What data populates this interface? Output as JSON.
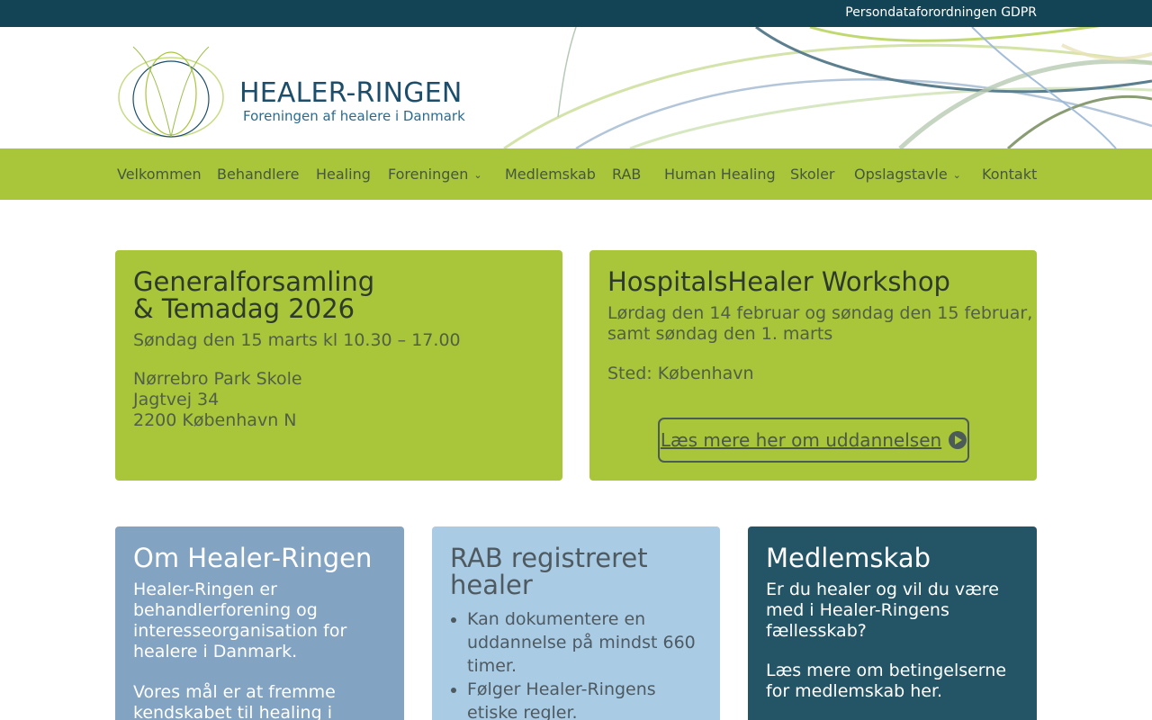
{
  "topbar": {
    "link": "Persondataforordningen GDPR"
  },
  "logo": {
    "title": "HEALER-RINGEN",
    "subtitle": "Foreningen af healere i Danmark"
  },
  "nav": [
    {
      "label": "Velkommen",
      "dropdown": false
    },
    {
      "label": "Behandlere",
      "dropdown": false
    },
    {
      "label": "Healing",
      "dropdown": false
    },
    {
      "label": "Foreningen",
      "dropdown": true
    },
    {
      "label": "Medlemskab",
      "dropdown": false
    },
    {
      "label": "RAB",
      "dropdown": false
    },
    {
      "label": "Human Healing",
      "dropdown": false
    },
    {
      "label": "Skoler",
      "dropdown": false
    },
    {
      "label": "Opslagstavle",
      "dropdown": true
    },
    {
      "label": "Kontakt",
      "dropdown": false
    }
  ],
  "card_general": {
    "title_line1": "Generalforsamling",
    "title_line2": "& Temadag 2026",
    "date": "Søndag den 15 marts kl 10.30 – 17.00",
    "address_line1": "Nørrebro Park Skole",
    "address_line2": "Jagtvej 34",
    "address_line3": "2200 København N"
  },
  "card_workshop": {
    "title": "HospitalsHealer Workshop",
    "dates_line1": "Lørdag den 14 februar og søndag den 15 februar,",
    "dates_line2": "samt søndag den 1. marts",
    "place": "Sted: København",
    "button": "Læs mere her om uddannelsen"
  },
  "card_about": {
    "title": "Om Healer-Ringen",
    "text1_line1": "Healer-Ringen er",
    "text1_line2": "behandlerforening og",
    "text1_line3": "interesseorganisation for",
    "text1_line4": "healere i Danmark.",
    "text2_line1": "Vores mål er at fremme",
    "text2_line2": "kendskabet til healing i"
  },
  "card_rab": {
    "title_line1": "RAB registreret",
    "title_line2": "healer",
    "bullets": [
      "Kan dokumentere en uddannelse på mindst 660 timer.",
      "Følger Healer-Ringens etiske regler."
    ]
  },
  "card_member": {
    "title": "Medlemskab",
    "text1_line1": "Er du healer og vil du være",
    "text1_line2": "med i Healer-Ringens",
    "text1_line3": "fællesskab?",
    "text2_line1": "Læs mere om betingelserne",
    "text2_line2": "for medlemskab her."
  },
  "colors": {
    "topbar": "#124455",
    "nav": "#a9c63b",
    "card_green": "#a9c63b",
    "card_blue": "#82a3c2",
    "card_lightblue": "#aacbe4",
    "card_teal": "#245566"
  }
}
